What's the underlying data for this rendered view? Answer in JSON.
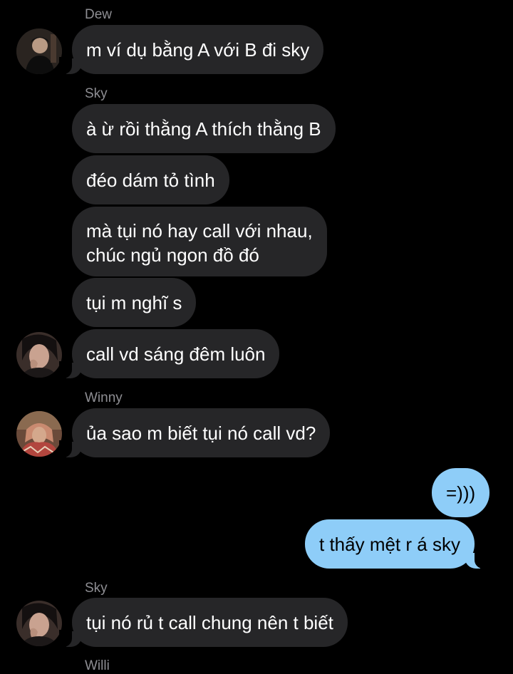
{
  "conversation": {
    "messages": [
      {
        "sender": "Dew",
        "text": "m ví dụ bằng A với B đi sky"
      },
      {
        "sender": "Sky",
        "text": "à ừ rồi thằng A thích thằng B"
      },
      {
        "text": "đéo dám tỏ tình"
      },
      {
        "text_line1": "mà tụi nó hay call với nhau,",
        "text_line2": "chúc ngủ ngon đồ đó"
      },
      {
        "text": "tụi m nghĩ s"
      },
      {
        "text": "call vd sáng đêm luôn"
      },
      {
        "sender": "Winny",
        "text": "ủa sao m biết tụi nó call vd?"
      },
      {
        "text": "=)))"
      },
      {
        "text": "t thấy mệt r á sky"
      },
      {
        "sender": "Sky",
        "text": "tụi nó rủ t call chung nên t biết"
      },
      {
        "sender": "Willi"
      }
    ]
  },
  "colors": {
    "background": "#000000",
    "incoming_bubble": "#262628",
    "outgoing_bubble": "#8ecdf8",
    "sender_name": "#8e8e93"
  },
  "avatars": [
    "dew-avatar",
    "sky-avatar",
    "winny-avatar",
    "sky-avatar"
  ]
}
